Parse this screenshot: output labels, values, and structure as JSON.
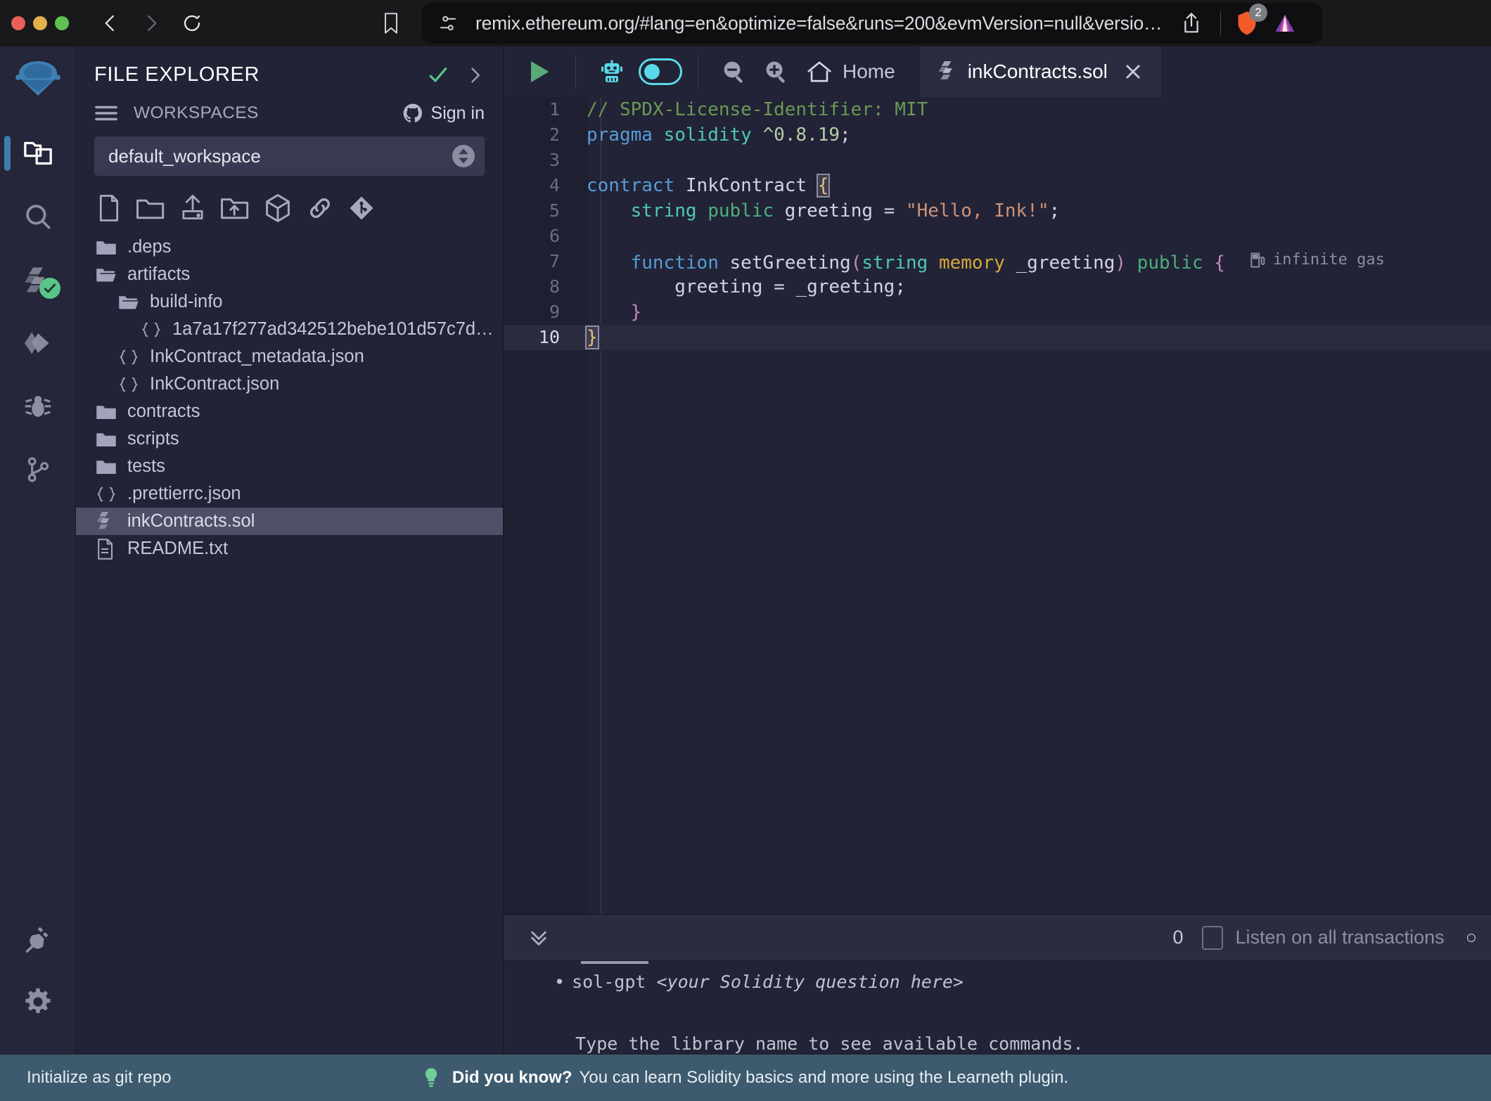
{
  "browser": {
    "url": "remix.ethereum.org/#lang=en&optimize=false&runs=200&evmVersion=null&version=...",
    "back_icon": "back-chevron-icon",
    "forward_icon": "forward-chevron-icon",
    "reload_icon": "reload-icon",
    "bookmark_icon": "bookmark-icon",
    "permissions_icon": "site-settings-icon",
    "share_icon": "share-icon",
    "brave_icon": "brave-shields-icon",
    "brave_badge": "2",
    "extension_icon": "extension-icon"
  },
  "rail": {
    "logo": "remix-logo",
    "items": [
      {
        "name": "file-explorer",
        "icon": "files-icon",
        "active": true
      },
      {
        "name": "search",
        "icon": "search-icon",
        "active": false
      },
      {
        "name": "solidity-compiler",
        "icon": "solidity-compiler-icon",
        "active": false,
        "badge": "check"
      },
      {
        "name": "deploy-run-transactions",
        "icon": "deploy-icon",
        "active": false
      },
      {
        "name": "debugger",
        "icon": "bug-icon",
        "active": false
      },
      {
        "name": "git",
        "icon": "git-branch-icon",
        "active": false
      }
    ],
    "bottom_items": [
      {
        "name": "plugin-manager",
        "icon": "plug-icon"
      },
      {
        "name": "settings",
        "icon": "gear-icon"
      }
    ]
  },
  "file_explorer": {
    "title": "FILE EXPLORER",
    "check_icon": "check-icon",
    "expand_icon": "chevron-right-icon",
    "workspaces_label": "WORKSPACES",
    "burger_icon": "hamburger-icon",
    "sign_in_label": "Sign in",
    "github_icon": "github-icon",
    "workspace_selected": "default_workspace",
    "stepper_icon": "up-down-stepper-icon",
    "actions": [
      {
        "name": "create-new-file",
        "icon": "new-file-icon"
      },
      {
        "name": "create-new-folder",
        "icon": "new-folder-icon"
      },
      {
        "name": "upload-file",
        "icon": "upload-file-icon"
      },
      {
        "name": "upload-folder",
        "icon": "upload-folder-icon"
      },
      {
        "name": "publish-to-gist",
        "icon": "cube-icon"
      },
      {
        "name": "connect-to-localhost",
        "icon": "link-icon"
      },
      {
        "name": "git-init",
        "icon": "git-diamond-icon"
      }
    ],
    "tree": [
      {
        "label": ".deps",
        "icon": "folder-icon",
        "depth": 1,
        "selected": false
      },
      {
        "label": "artifacts",
        "icon": "folder-open-icon",
        "depth": 1,
        "selected": false
      },
      {
        "label": "build-info",
        "icon": "folder-open-icon",
        "depth": 2,
        "selected": false
      },
      {
        "label": "1a7a17f277ad342512bebe101d57c7d9....",
        "icon": "json-icon",
        "depth": 3,
        "selected": false
      },
      {
        "label": "InkContract_metadata.json",
        "icon": "json-icon",
        "depth": 2,
        "selected": false
      },
      {
        "label": "InkContract.json",
        "icon": "json-icon",
        "depth": 2,
        "selected": false
      },
      {
        "label": "contracts",
        "icon": "folder-icon",
        "depth": 1,
        "selected": false
      },
      {
        "label": "scripts",
        "icon": "folder-icon",
        "depth": 1,
        "selected": false
      },
      {
        "label": "tests",
        "icon": "folder-icon",
        "depth": 1,
        "selected": false
      },
      {
        "label": ".prettierrc.json",
        "icon": "json-icon",
        "depth": 1,
        "selected": false
      },
      {
        "label": "inkContracts.sol",
        "icon": "solidity-icon",
        "depth": 1,
        "selected": true
      },
      {
        "label": "README.txt",
        "icon": "text-file-icon",
        "depth": 1,
        "selected": false
      }
    ]
  },
  "editor": {
    "toolbar": {
      "run_icon": "play-icon",
      "ai_icon": "robot-icon",
      "ai_toggle": "ai-copilot-toggle",
      "zoom_out_icon": "zoom-out-icon",
      "zoom_in_icon": "zoom-in-icon",
      "home_icon": "home-icon",
      "home_label": "Home"
    },
    "tab": {
      "label": "inkContracts.sol",
      "file_icon": "solidity-icon",
      "close_icon": "close-icon"
    },
    "gas_hint": "infinite gas",
    "gas_icon": "gas-pump-icon",
    "lines": [
      {
        "n": "1",
        "tokens": [
          {
            "t": "// SPDX-License-Identifier: MIT",
            "c": "tok-c"
          }
        ]
      },
      {
        "n": "2",
        "tokens": [
          {
            "t": "pragma",
            "c": "tok-k"
          },
          {
            "t": " ",
            "c": "tok-id"
          },
          {
            "t": "solidity",
            "c": "tok-k2"
          },
          {
            "t": " ",
            "c": "tok-id"
          },
          {
            "t": "^0.8.19",
            "c": "tok-n"
          },
          {
            "t": ";",
            "c": "tok-id"
          }
        ]
      },
      {
        "n": "3",
        "tokens": []
      },
      {
        "n": "4",
        "tokens": [
          {
            "t": "contract",
            "c": "tok-k"
          },
          {
            "t": " ",
            "c": "tok-id"
          },
          {
            "t": "InkContract",
            "c": "tok-id"
          },
          {
            "t": " ",
            "c": "tok-id"
          },
          {
            "t": "{",
            "c": "tok-brace-hl"
          }
        ]
      },
      {
        "n": "5",
        "tokens": [
          {
            "t": "    ",
            "c": "tok-id"
          },
          {
            "t": "string",
            "c": "tok-k2"
          },
          {
            "t": " ",
            "c": "tok-id"
          },
          {
            "t": "public",
            "c": "tok-mod"
          },
          {
            "t": " ",
            "c": "tok-id"
          },
          {
            "t": "greeting",
            "c": "tok-id"
          },
          {
            "t": " = ",
            "c": "tok-id"
          },
          {
            "t": "\"Hello, Ink!\"",
            "c": "tok-s"
          },
          {
            "t": ";",
            "c": "tok-id"
          }
        ]
      },
      {
        "n": "6",
        "tokens": []
      },
      {
        "n": "7",
        "tokens": [
          {
            "t": "    ",
            "c": "tok-id"
          },
          {
            "t": "function",
            "c": "tok-k"
          },
          {
            "t": " ",
            "c": "tok-id"
          },
          {
            "t": "setGreeting",
            "c": "tok-id"
          },
          {
            "t": "(",
            "c": "tok-p"
          },
          {
            "t": "string",
            "c": "tok-k2"
          },
          {
            "t": " ",
            "c": "tok-id"
          },
          {
            "t": "memory",
            "c": "tok-mem"
          },
          {
            "t": " ",
            "c": "tok-id"
          },
          {
            "t": "_greeting",
            "c": "tok-id"
          },
          {
            "t": ")",
            "c": "tok-p"
          },
          {
            "t": " ",
            "c": "tok-id"
          },
          {
            "t": "public",
            "c": "tok-mod"
          },
          {
            "t": " ",
            "c": "tok-id"
          },
          {
            "t": "{",
            "c": "tok-p"
          }
        ]
      },
      {
        "n": "8",
        "tokens": [
          {
            "t": "        ",
            "c": "tok-id"
          },
          {
            "t": "greeting",
            "c": "tok-id"
          },
          {
            "t": " = ",
            "c": "tok-id"
          },
          {
            "t": "_greeting",
            "c": "tok-id"
          },
          {
            "t": ";",
            "c": "tok-id"
          }
        ]
      },
      {
        "n": "9",
        "tokens": [
          {
            "t": "    ",
            "c": "tok-id"
          },
          {
            "t": "}",
            "c": "tok-p"
          }
        ]
      },
      {
        "n": "10",
        "tokens": [
          {
            "t": "}",
            "c": "tok-brace-hl"
          }
        ],
        "current": true
      }
    ]
  },
  "terminal": {
    "collapse_icon": "chevrons-down-icon",
    "count": "0",
    "listen_label": "Listen on all transactions",
    "listen_checkbox": "listen-all-transactions-checkbox",
    "body_lines": [
      {
        "bullet": true,
        "plain": "sol-gpt ",
        "em": "<your Solidity question here>"
      },
      {
        "bullet": false,
        "plain": "",
        "em": ""
      },
      {
        "bullet": false,
        "plain": "  Type the library name to see available commands.",
        "em": ""
      }
    ],
    "prompt": ">"
  },
  "status_bar": {
    "left_label": "Initialize as git repo",
    "bulb_icon": "lightbulb-icon",
    "did_you_know": "Did you know?",
    "tip": "You can learn Solidity basics and more using the Learneth plugin."
  }
}
